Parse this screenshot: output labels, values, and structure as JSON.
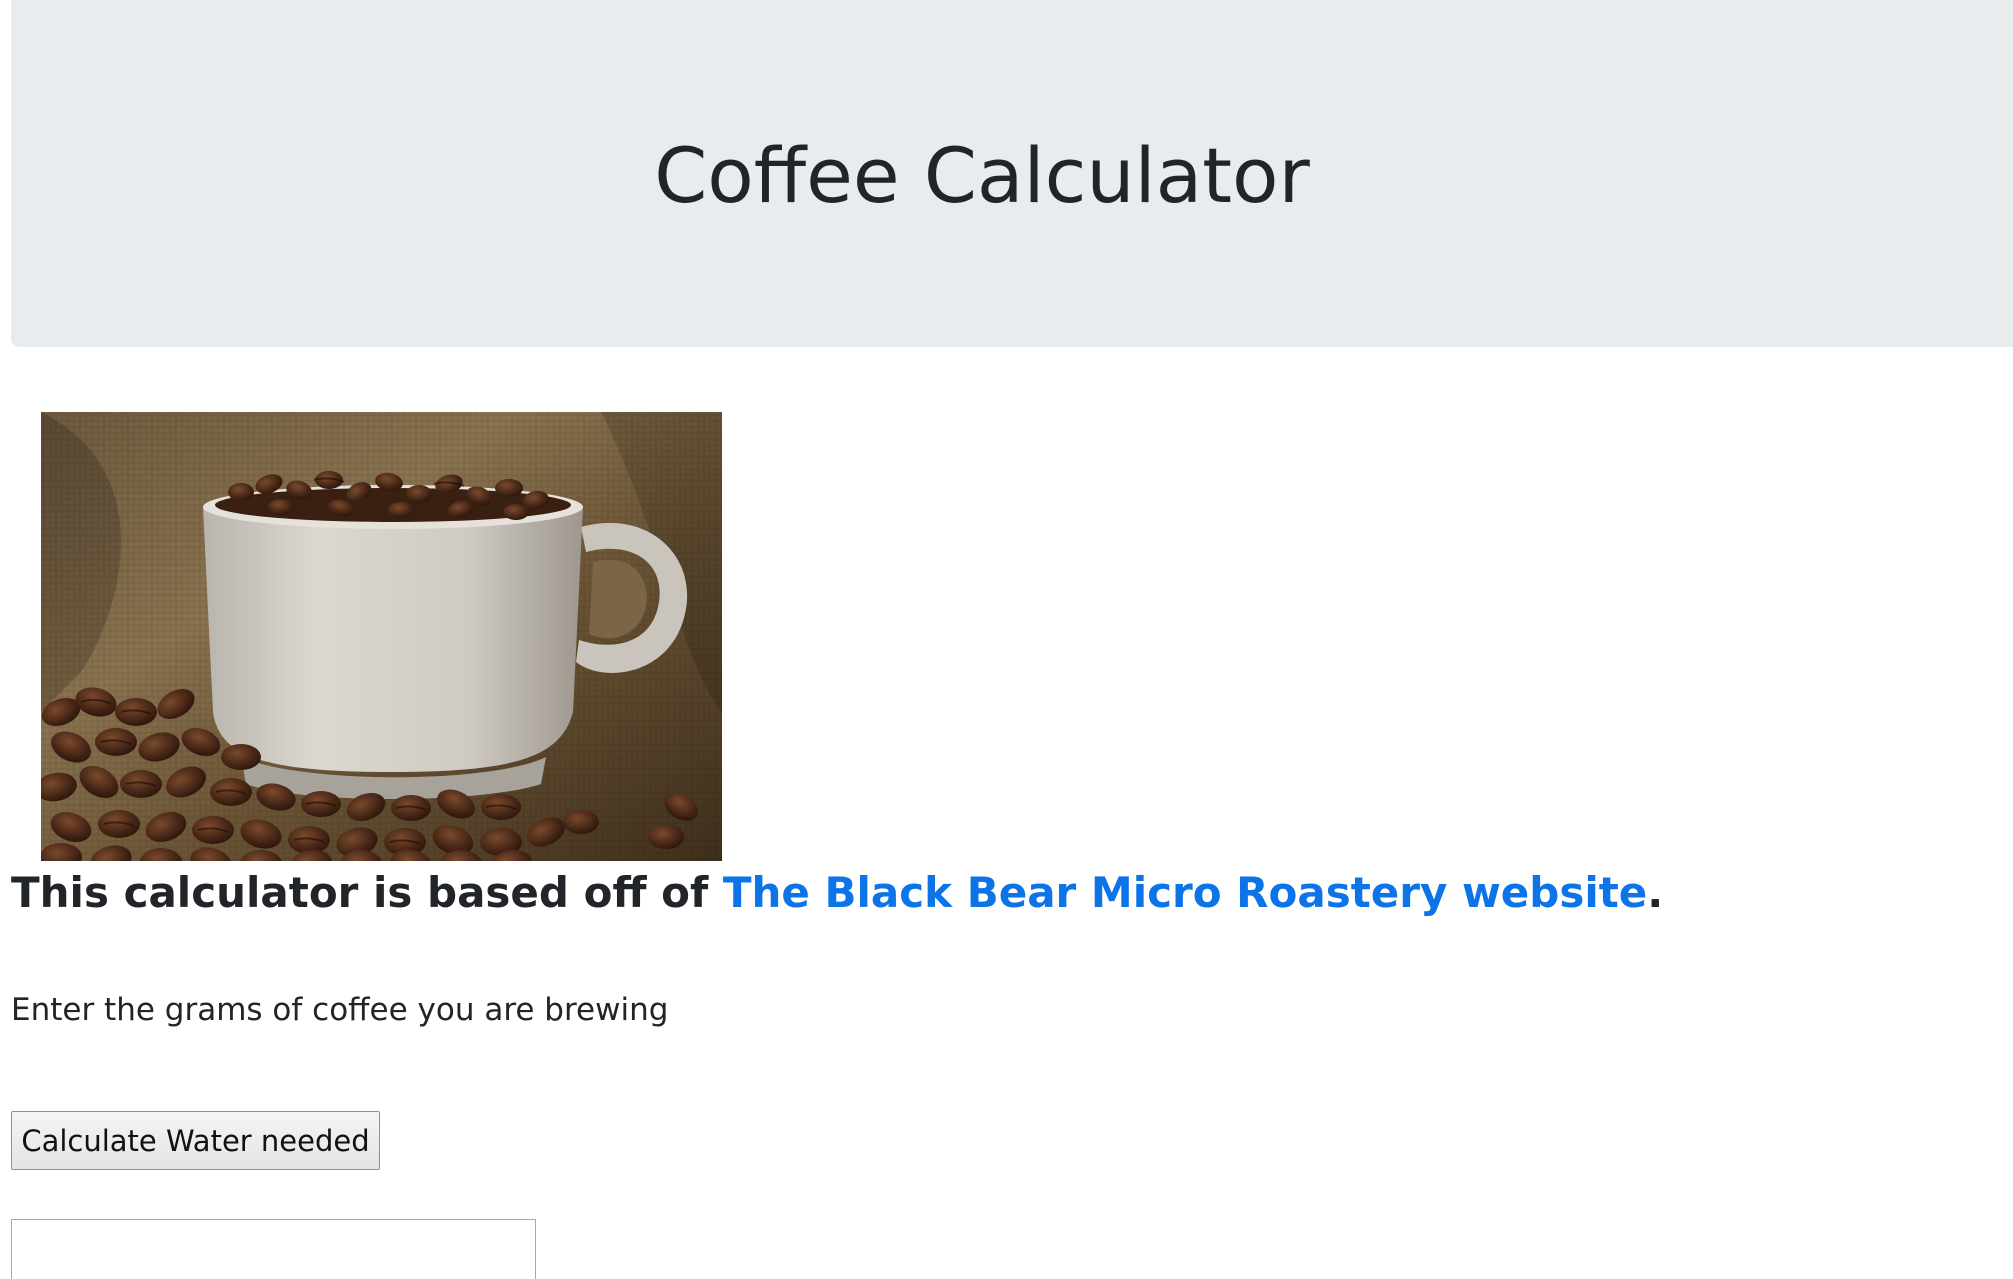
{
  "header": {
    "title": "Coffee Calculator"
  },
  "hero_image": {
    "description_icon": "coffee-cup-with-beans-photo"
  },
  "intro": {
    "prefix": "This calculator is based off of ",
    "link_text": "The Black Bear Micro Roastery website",
    "suffix": "."
  },
  "form": {
    "prompt": "Enter the grams of coffee you are brewing",
    "calculate_label": "Calculate Water needed",
    "result_value": ""
  },
  "colors": {
    "jumbotron_bg": "#e9ecef",
    "text": "#212529",
    "link": "#0d74e7"
  }
}
